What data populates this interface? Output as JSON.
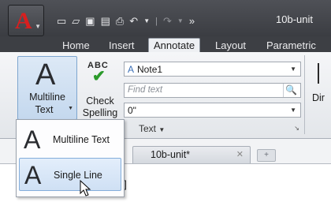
{
  "title_bar": {
    "app_icon": "autocad-logo-icon",
    "document_title": "10b-unit",
    "quick_access": [
      "new-icon",
      "open-icon",
      "save-icon",
      "save-as-icon",
      "plot-icon",
      "undo-icon",
      "redo-icon",
      "more-icon"
    ]
  },
  "tabs": [
    {
      "label": "Home",
      "active": false
    },
    {
      "label": "Insert",
      "active": false
    },
    {
      "label": "Annotate",
      "active": true
    },
    {
      "label": "Layout",
      "active": false
    },
    {
      "label": "Parametric",
      "active": false
    }
  ],
  "ribbon": {
    "multiline_text": {
      "glyph": "A",
      "label_line1": "Multiline",
      "label_line2": "Text"
    },
    "check_spelling": {
      "glyph": "ABC",
      "label_line1": "Check",
      "label_line2": "Spelling"
    },
    "text_style": {
      "value": "Note1"
    },
    "find_text": {
      "placeholder": "Find text"
    },
    "text_height": {
      "value": "0\""
    },
    "panel_label": "Text",
    "dimension_label": "Dir"
  },
  "menu": {
    "items": [
      {
        "glyph": "A",
        "label": "Multiline Text",
        "selected": false
      },
      {
        "glyph": "A",
        "label": "Single Line",
        "selected": true
      }
    ]
  },
  "file_tab": {
    "name": "10b-unit*"
  },
  "viewport": {
    "control_text": "e]"
  }
}
